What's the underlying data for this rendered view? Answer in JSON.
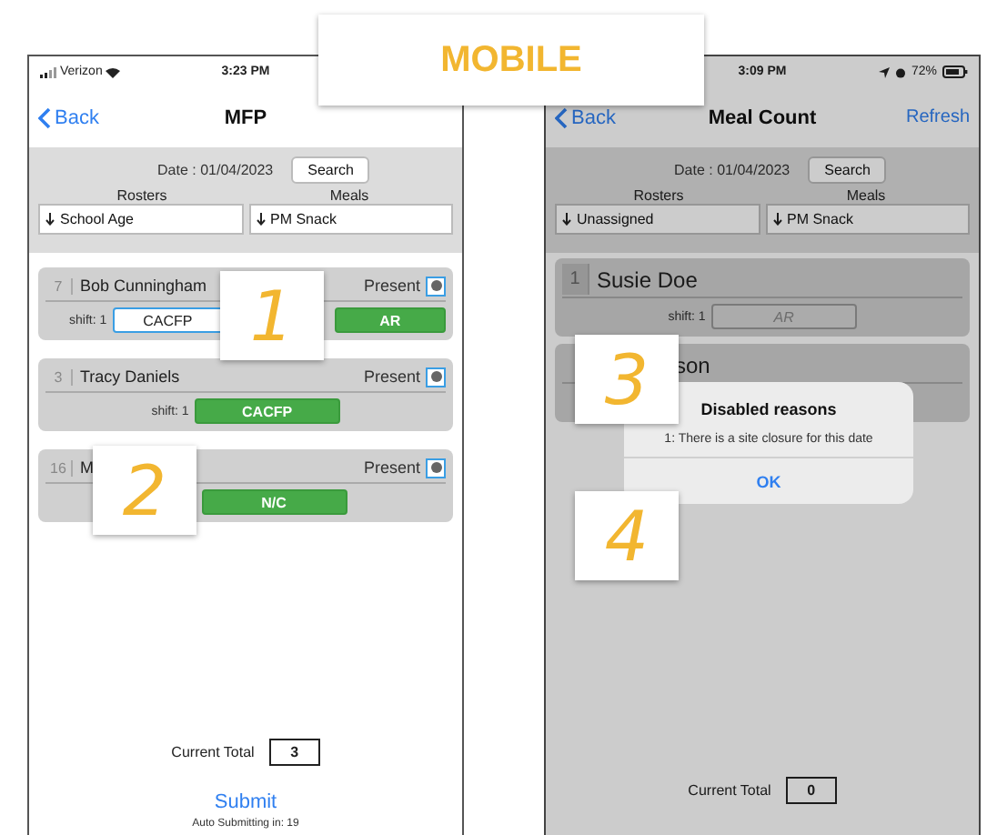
{
  "heading": "MOBILE",
  "screens": [
    {
      "dimmed": false,
      "status": {
        "carrier": "Verizon",
        "time": "3:23 PM"
      },
      "nav": {
        "back": "Back",
        "title": "MFP"
      },
      "filters": {
        "date": "Date : 01/04/2023",
        "search": "Search",
        "rosters_label": "Rosters",
        "meals_label": "Meals",
        "roster": "School Age",
        "meal": "PM Snack"
      },
      "cards": [
        {
          "number": "7",
          "name": "Bob Cunningham",
          "present_label": "Present",
          "present": true,
          "shift": "shift: 1",
          "pills": [
            {
              "label": "CACFP",
              "kind": "outline"
            },
            {
              "label": "AR",
              "kind": "active"
            }
          ]
        },
        {
          "number": "3",
          "name": "Tracy Daniels",
          "present_label": "Present",
          "present": true,
          "shift": "shift: 1",
          "pills": [
            {
              "label": "CACFP",
              "kind": "active"
            }
          ]
        },
        {
          "number": "16",
          "name": "M",
          "present_label": "Present",
          "present": true,
          "pills": [
            {
              "label": "N/C",
              "kind": "active"
            }
          ]
        }
      ],
      "total_label": "Current Total",
      "total": "3",
      "submit": "Submit",
      "auto_submit": "Auto Submitting in: 19"
    },
    {
      "dimmed": true,
      "status": {
        "time": "3:09 PM",
        "battery": "72%"
      },
      "nav": {
        "back": "Back",
        "title": "Meal Count",
        "action": "Refresh"
      },
      "filters": {
        "date": "Date : 01/04/2023",
        "search": "Search",
        "rosters_label": "Rosters",
        "meals_label": "Meals",
        "roster": "Unassigned",
        "meal": "PM Snack"
      },
      "cards": [
        {
          "number": "1",
          "name": "Susie Doe",
          "shift": "shift: 1",
          "pills": [
            {
              "label": "AR",
              "kind": "disabled"
            }
          ]
        },
        {
          "name": "son",
          "cut_off": true
        }
      ],
      "total_label": "Current Total",
      "total": "0"
    }
  ],
  "dialog": {
    "title": "Disabled reasons",
    "message": "1: There is a site closure for this date",
    "button": "OK"
  },
  "callouts": [
    {
      "label": "1"
    },
    {
      "label": "2"
    },
    {
      "label": "3"
    },
    {
      "label": "4"
    }
  ]
}
